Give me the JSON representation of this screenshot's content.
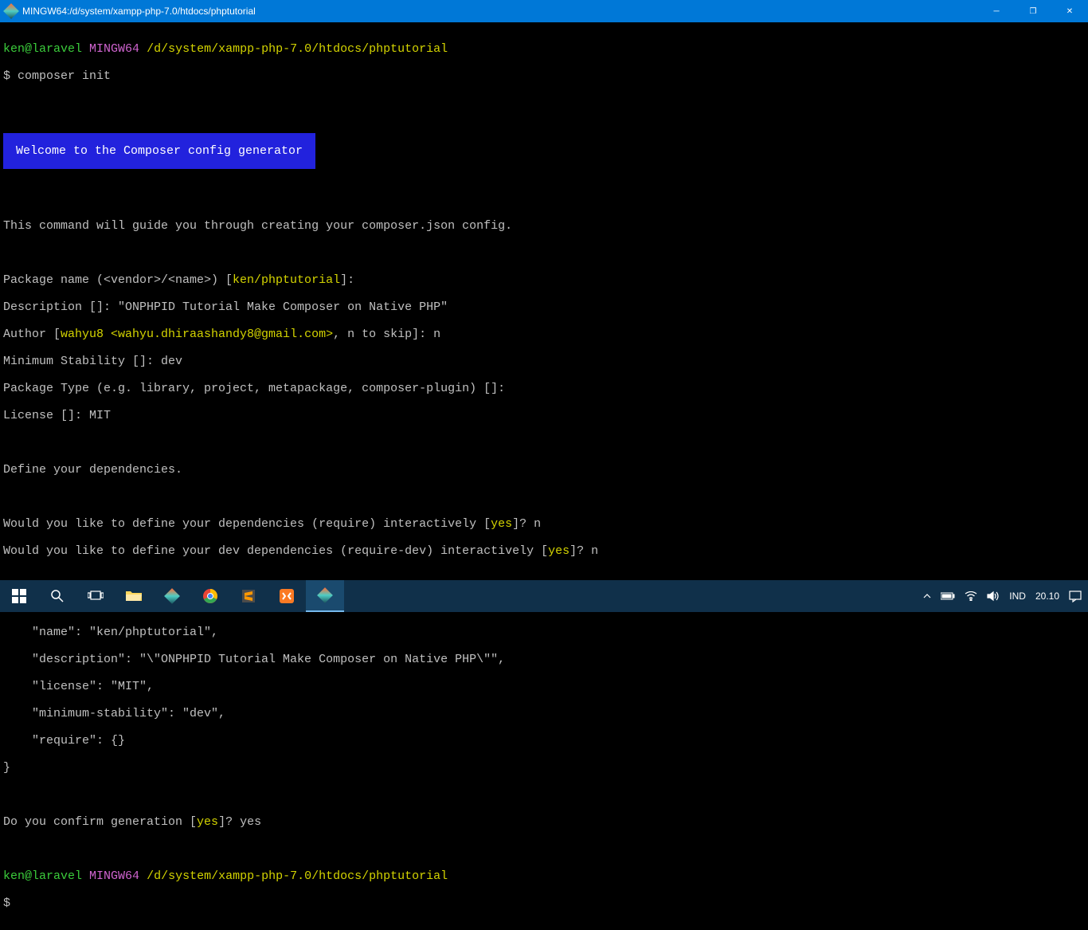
{
  "titlebar": {
    "title": "MINGW64:/d/system/xampp-php-7.0/htdocs/phptutorial"
  },
  "prompt1": {
    "user": "ken@laravel",
    "sys": "MINGW64",
    "path": "/d/system/xampp-php-7.0/htdocs/phptutorial",
    "command": "$ composer init"
  },
  "banner": "Welcome to the Composer config generator",
  "guide": "This command will guide you through creating your composer.json config.",
  "pkg": {
    "label": "Package name (<vendor>/<name>) [",
    "default": "ken/phptutorial",
    "close": "]:"
  },
  "desc": "Description []: \"ONPHPID Tutorial Make Composer on Native PHP\"",
  "author": {
    "label": "Author [",
    "default": "wahyu8 <wahyu.dhiraashandy8@gmail.com>",
    "rest": ", n to skip]: n"
  },
  "minstab": "Minimum Stability []: dev",
  "pkgtype": "Package Type (e.g. library, project, metapackage, composer-plugin) []:",
  "license": "License []: MIT",
  "definedeps": "Define your dependencies.",
  "req": {
    "label": "Would you like to define your dependencies (require) interactively [",
    "yes": "yes",
    "rest": "]? n"
  },
  "reqdev": {
    "label": "Would you like to define your dev dependencies (require-dev) interactively [",
    "yes": "yes",
    "rest": "]? n"
  },
  "json": {
    "open": "{",
    "name": "    \"name\": \"ken/phptutorial\",",
    "desc": "    \"description\": \"\\\"ONPHPID Tutorial Make Composer on Native PHP\\\"\",",
    "lic": "    \"license\": \"MIT\",",
    "min": "    \"minimum-stability\": \"dev\",",
    "req": "    \"require\": {}",
    "close": "}"
  },
  "confirm": {
    "label": "Do you confirm generation [",
    "yes": "yes",
    "rest": "]? yes"
  },
  "prompt2": {
    "user": "ken@laravel",
    "sys": "MINGW64",
    "path": "/d/system/xampp-php-7.0/htdocs/phptutorial",
    "command": "$"
  },
  "systray": {
    "lang": "IND",
    "time": "20.10"
  },
  "win": {
    "min": "─",
    "max": "❐",
    "close": "✕"
  }
}
